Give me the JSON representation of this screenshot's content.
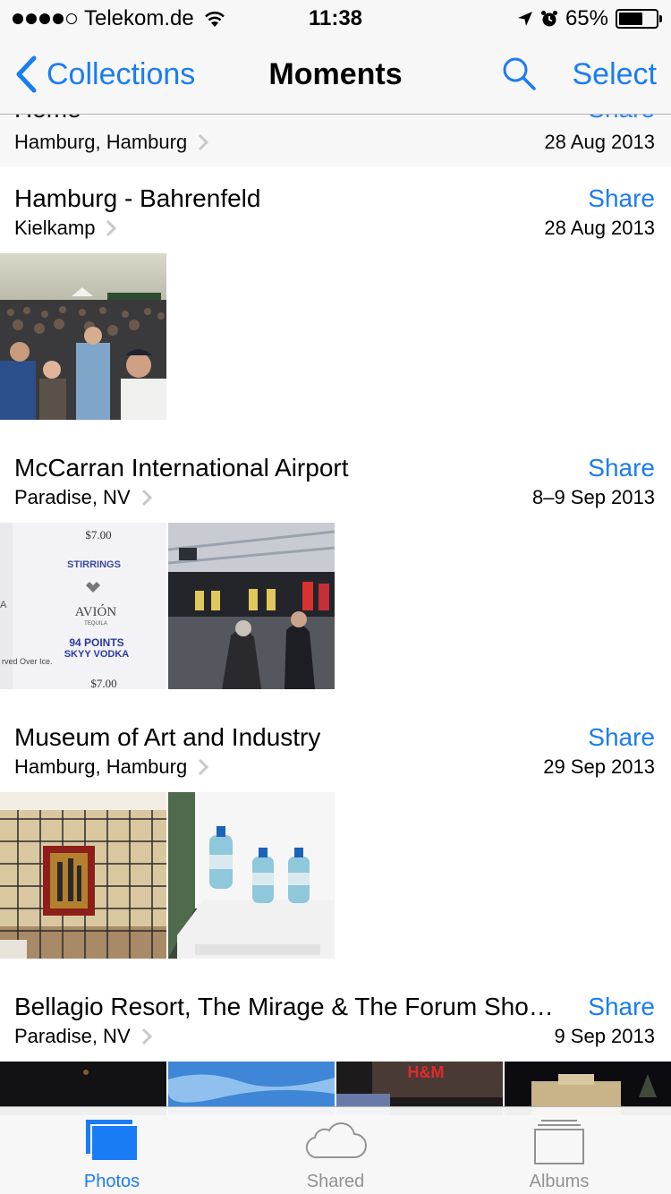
{
  "status_bar": {
    "carrier": "Telekom.de",
    "time": "11:38",
    "battery": "65%",
    "battery_level": 0.65
  },
  "nav": {
    "back_label": "Collections",
    "title": "Moments",
    "select_label": "Select"
  },
  "partial_moment": {
    "title": "Home",
    "share": "Share",
    "place": "Hamburg, Hamburg",
    "date": "28 Aug 2013"
  },
  "moments": [
    {
      "title": "Hamburg - Bahrenfeld",
      "share": "Share",
      "place": "Kielkamp",
      "date": "28 Aug 2013"
    },
    {
      "title": "McCarran International Airport",
      "share": "Share",
      "place": "Paradise, NV",
      "date": "8–9 Sep 2013"
    },
    {
      "title": "Museum of Art and Industry",
      "share": "Share",
      "place": "Hamburg, Hamburg",
      "date": "29 Sep 2013"
    },
    {
      "title": "Bellagio Resort, The Mirage & The Forum Sho…",
      "share": "Share",
      "place": "Paradise, NV",
      "date": "9 Sep 2013"
    }
  ],
  "photo_text": {
    "price_top": "$7.00",
    "brand1": "STIRRINGS",
    "brand2": "AVIÓN",
    "brand2_sub": "TEQUILA",
    "points": "94 POINTS",
    "brand3": "SKYY VODKA",
    "served": "rved Over Ice.",
    "price_bottom": "$7.00",
    "edge_letter": "A",
    "store_sign": "H&M"
  },
  "tabs": [
    {
      "label": "Photos",
      "icon": "photos-icon",
      "active": true
    },
    {
      "label": "Shared",
      "icon": "cloud-icon",
      "active": false
    },
    {
      "label": "Albums",
      "icon": "albums-icon",
      "active": false
    }
  ],
  "colors": {
    "accent": "#1a7cf5",
    "inactive_tab": "#929292",
    "bar_background": "#f7f7f7"
  }
}
